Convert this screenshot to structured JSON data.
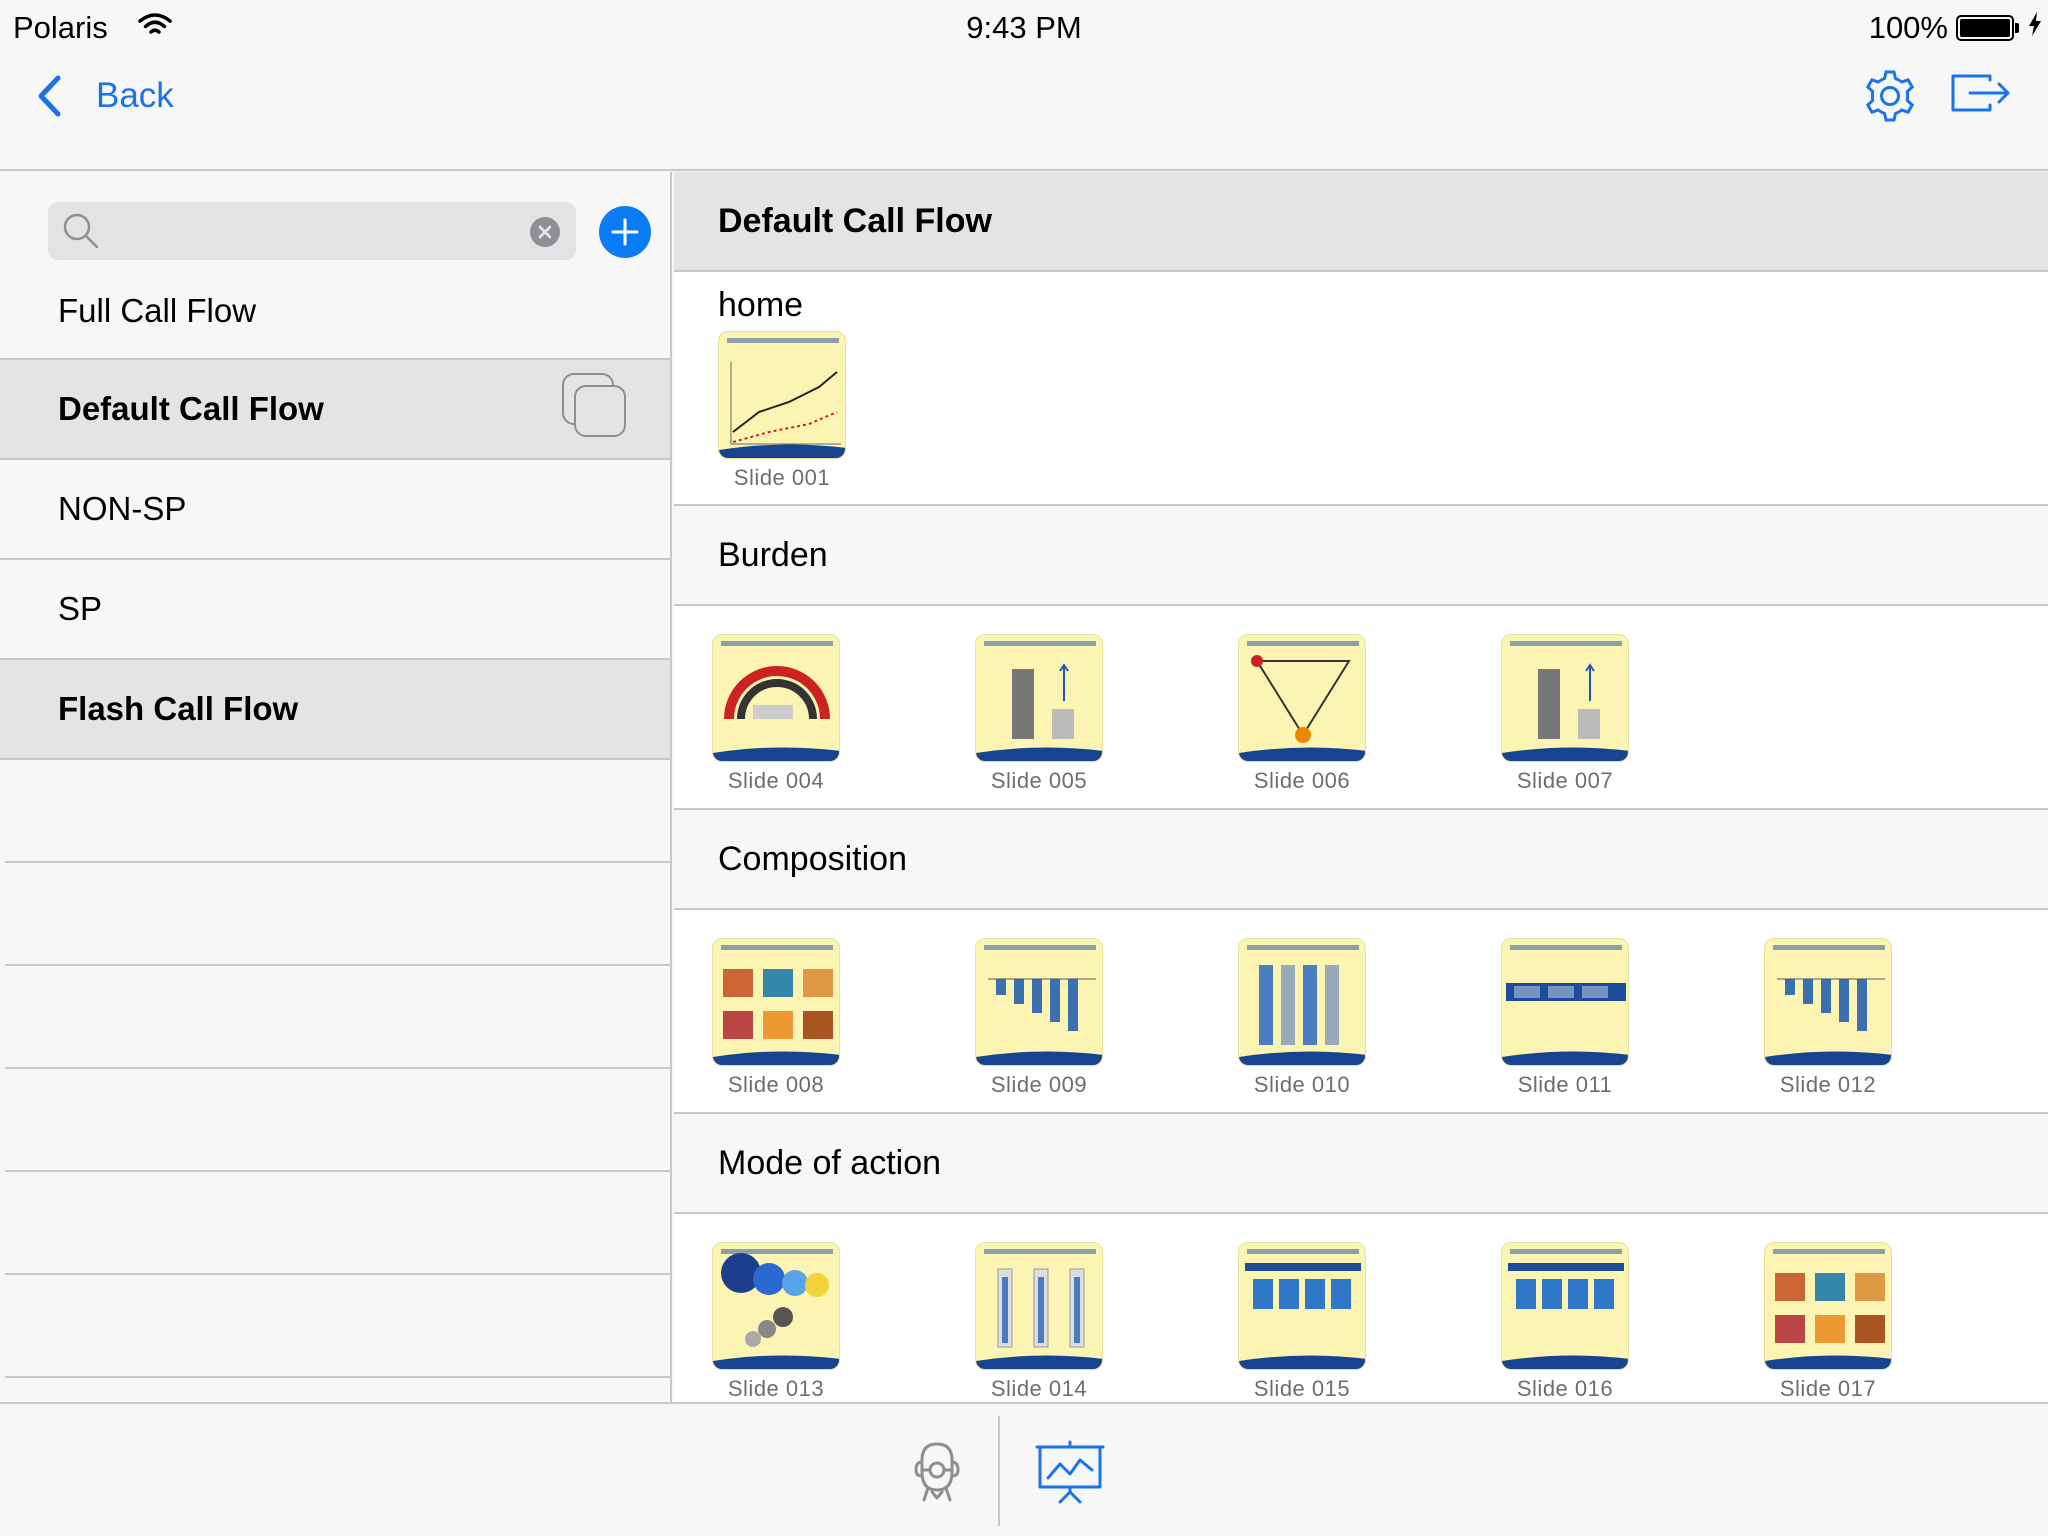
{
  "status_bar": {
    "carrier": "Polaris",
    "time": "9:43 PM",
    "battery": "100%"
  },
  "nav": {
    "back_label": "Back",
    "accent_color": "#1a73e8"
  },
  "sidebar": {
    "search": {
      "value": "",
      "placeholder": ""
    },
    "items": [
      {
        "label": "Full Call Flow",
        "selected": false
      },
      {
        "label": "Default Call Flow",
        "selected": true
      },
      {
        "label": "NON-SP",
        "selected": false
      },
      {
        "label": "SP",
        "selected": false
      },
      {
        "label": "Flash Call Flow",
        "selected": true
      }
    ]
  },
  "content": {
    "title": "Default Call Flow",
    "home": {
      "title": "home",
      "slides": [
        {
          "label": "Slide 001",
          "kind": "line"
        }
      ]
    },
    "sections": [
      {
        "title": "Burden",
        "slides": [
          {
            "label": "Slide 004",
            "kind": "gauge"
          },
          {
            "label": "Slide 005",
            "kind": "bars2"
          },
          {
            "label": "Slide 006",
            "kind": "triangle"
          },
          {
            "label": "Slide 007",
            "kind": "bars2"
          }
        ]
      },
      {
        "title": "Composition",
        "slides": [
          {
            "label": "Slide 008",
            "kind": "photos"
          },
          {
            "label": "Slide 009",
            "kind": "neg-bars"
          },
          {
            "label": "Slide 010",
            "kind": "tall-bars"
          },
          {
            "label": "Slide 011",
            "kind": "flow"
          },
          {
            "label": "Slide 012",
            "kind": "neg-bars"
          }
        ]
      },
      {
        "title": "Mode of action",
        "slides": [
          {
            "label": "Slide 013",
            "kind": "circles"
          },
          {
            "label": "Slide 014",
            "kind": "thin-bars"
          },
          {
            "label": "Slide 015",
            "kind": "blue-bars"
          },
          {
            "label": "Slide 016",
            "kind": "blue-bars"
          },
          {
            "label": "Slide 017",
            "kind": "photos"
          }
        ]
      }
    ]
  },
  "tab_bar": {
    "items": [
      {
        "icon": "doctor-icon"
      },
      {
        "icon": "presentation-icon",
        "active": true
      }
    ]
  }
}
